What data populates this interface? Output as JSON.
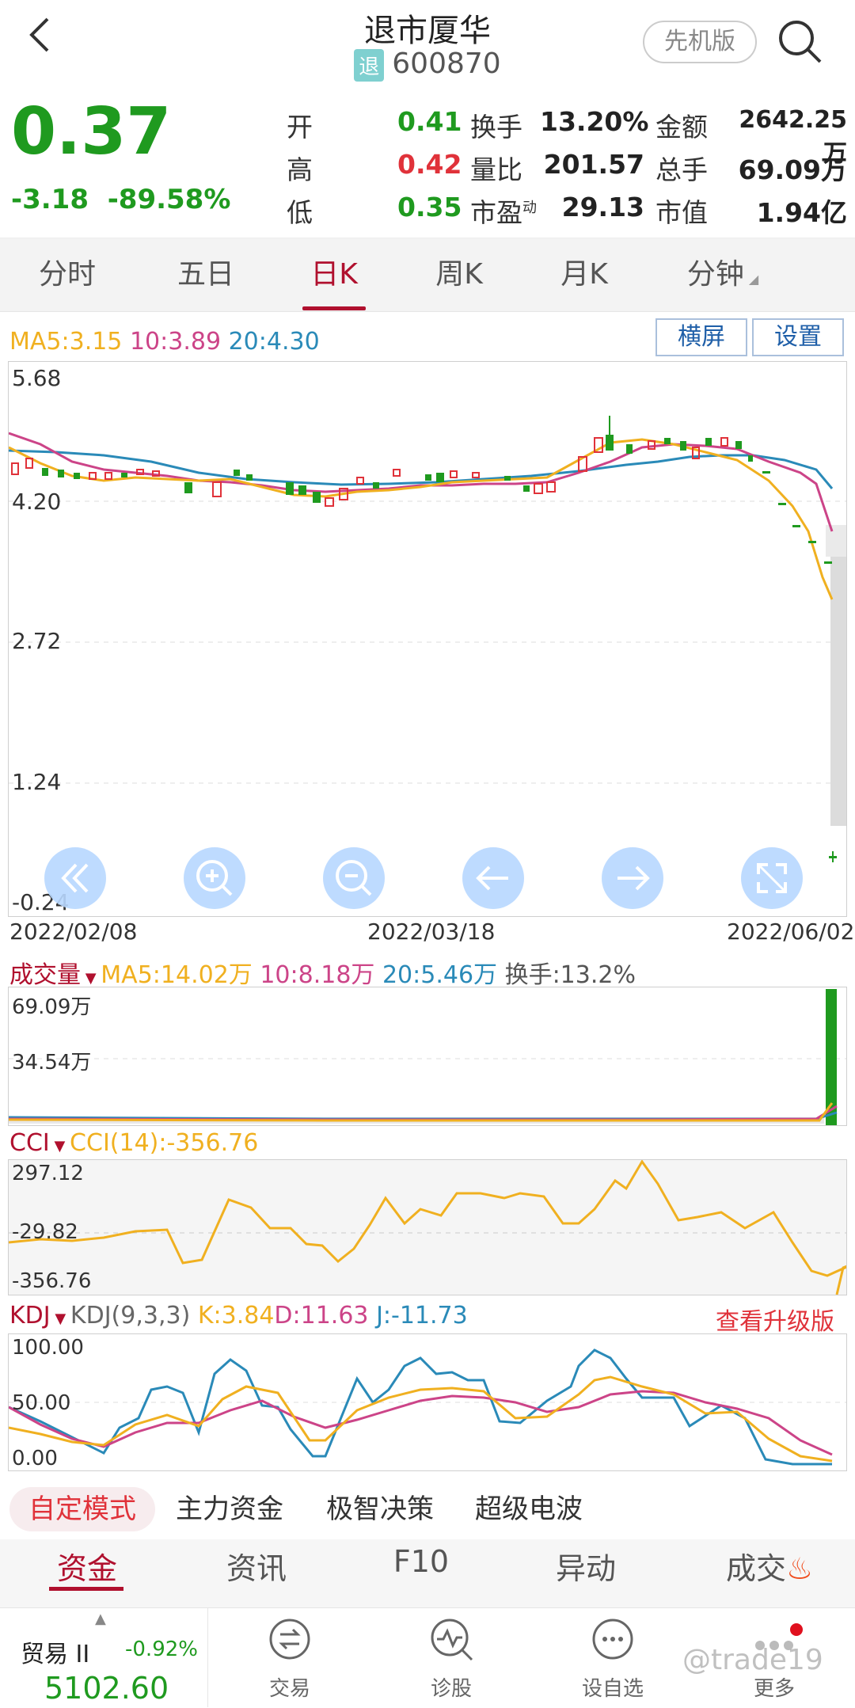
{
  "header": {
    "title": "退市厦华",
    "badge": "退",
    "code": "600870",
    "version_button": "先机版"
  },
  "quote": {
    "price": "0.37",
    "change": "-3.18",
    "change_pct": "-89.58%",
    "rows": [
      {
        "l1": "开",
        "v1": "0.41",
        "l2": "换手",
        "v2": "13.20%",
        "l3": "金额",
        "v3": "2642.25万"
      },
      {
        "l1": "高",
        "v1": "0.42",
        "l2": "量比",
        "v2": "201.57",
        "l3": "总手",
        "v3": "69.09万"
      },
      {
        "l1": "低",
        "v1": "0.35",
        "l2": "市盈",
        "l2_sup": "动",
        "v2": "29.13",
        "l3": "市值",
        "v3": "1.94亿"
      }
    ]
  },
  "tabs": [
    "分时",
    "五日",
    "日K",
    "周K",
    "月K",
    "分钟"
  ],
  "active_tab": "日K",
  "kline": {
    "ma_labels": {
      "ma5": "MA5:3.15",
      "ma10": "10:3.89",
      "ma20": "20:4.30"
    },
    "landscape_button": "横屏",
    "settings_button": "设置",
    "y_labels": [
      "5.68",
      "4.20",
      "2.72",
      "1.24",
      "-0.24"
    ],
    "x_labels": [
      "2022/02/08",
      "2022/03/18",
      "2022/06/02"
    ]
  },
  "volume": {
    "title": "成交量",
    "ma5": "MA5:14.02万",
    "ma10": "10:8.18万",
    "ma20": "20:5.46万",
    "turnover": "换手:13.2%",
    "y_labels": [
      "69.09万",
      "34.54万"
    ]
  },
  "cci": {
    "title": "CCI",
    "value": "CCI(14):-356.76",
    "y_labels": [
      "297.12",
      "-29.82",
      "-356.76"
    ]
  },
  "kdj": {
    "title": "KDJ",
    "params": "KDJ(9,3,3)",
    "k": "K:3.84",
    "d": "D:11.63",
    "j": "J:-11.73",
    "upgrade": "查看升级版",
    "y_labels": [
      "100.00",
      "50.00",
      "0.00"
    ]
  },
  "modes": [
    "自定模式",
    "主力资金",
    "极智决策",
    "超级电波"
  ],
  "bottom_tabs": [
    "资金",
    "资讯",
    "F10",
    "异动",
    "成交"
  ],
  "index": {
    "name": "贸易 II",
    "change": "-0.92%",
    "value": "5102.60"
  },
  "nav": [
    "交易",
    "诊股",
    "设自选",
    "更多"
  ],
  "watermark": "@trade19",
  "colors": {
    "up": "#e0323a",
    "down": "#1f9a1f",
    "ma5": "#f0b020",
    "ma10": "#cc4488",
    "ma20": "#2a8ab8",
    "accent": "#b0102e"
  },
  "chart_data": {
    "type": "candlestick",
    "x_range": [
      "2022/02/08",
      "2022/06/02"
    ],
    "ylim": [
      -0.24,
      5.68
    ],
    "last": {
      "open": 0.41,
      "high": 0.42,
      "low": 0.35,
      "close": 0.37
    },
    "kdj": {
      "K": 3.84,
      "D": 11.63,
      "J": -11.73
    },
    "cci": -356.76
  }
}
